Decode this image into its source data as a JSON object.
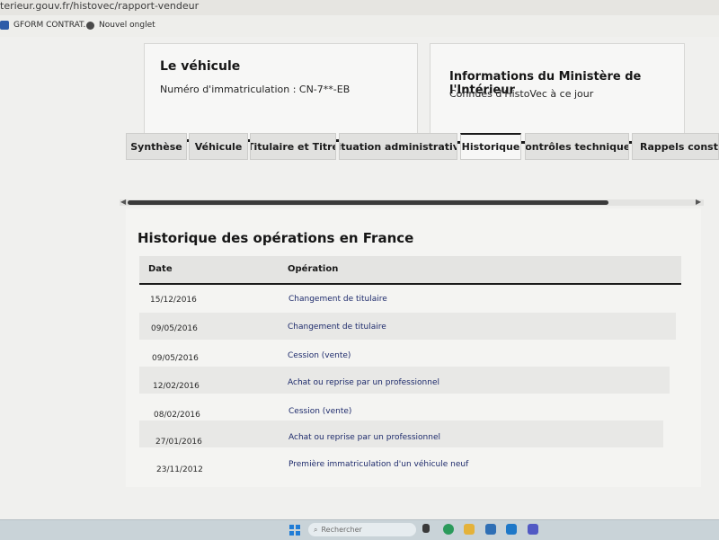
{
  "browser": {
    "url": "terieur.gouv.fr/histovec/rapport-vendeur",
    "bookmarks": [
      {
        "label": "GFORM CONTRAT..."
      },
      {
        "label": "Nouvel onglet"
      }
    ]
  },
  "vehicle_card": {
    "title": "Le véhicule",
    "plate_text": "Numéro d'immatriculation : CN-7**-EB"
  },
  "ministry_card": {
    "title": "Informations du Ministère de l'Intérieur",
    "text": "Connues d'HistoVec à ce jour"
  },
  "tabs": [
    {
      "label": "Synthèse"
    },
    {
      "label": "Véhicule"
    },
    {
      "label": "Titulaire et Titre"
    },
    {
      "label": "Situation administrative"
    },
    {
      "label": "Historique"
    },
    {
      "label": "Contrôles techniques"
    },
    {
      "label": "Rappels constru"
    }
  ],
  "active_tab": "Historique",
  "history": {
    "title": "Historique des opérations en France",
    "columns": {
      "date": "Date",
      "operation": "Opération"
    },
    "rows": [
      {
        "date": "15/12/2016",
        "operation": "Changement de titulaire"
      },
      {
        "date": "09/05/2016",
        "operation": "Changement de titulaire"
      },
      {
        "date": "09/05/2016",
        "operation": "Cession (vente)"
      },
      {
        "date": "12/02/2016",
        "operation": "Achat ou reprise par un professionnel"
      },
      {
        "date": "08/02/2016",
        "operation": "Cession (vente)"
      },
      {
        "date": "27/01/2016",
        "operation": "Achat ou reprise par un professionnel"
      },
      {
        "date": "23/11/2012",
        "operation": "Première immatriculation d'un véhicule neuf"
      }
    ]
  },
  "taskbar": {
    "search_placeholder": "Rechercher"
  },
  "colors": {
    "accent_dark": "#1a1a1a",
    "link_blue": "#1d2a6b",
    "windows_blue": "#1f7cd6"
  }
}
